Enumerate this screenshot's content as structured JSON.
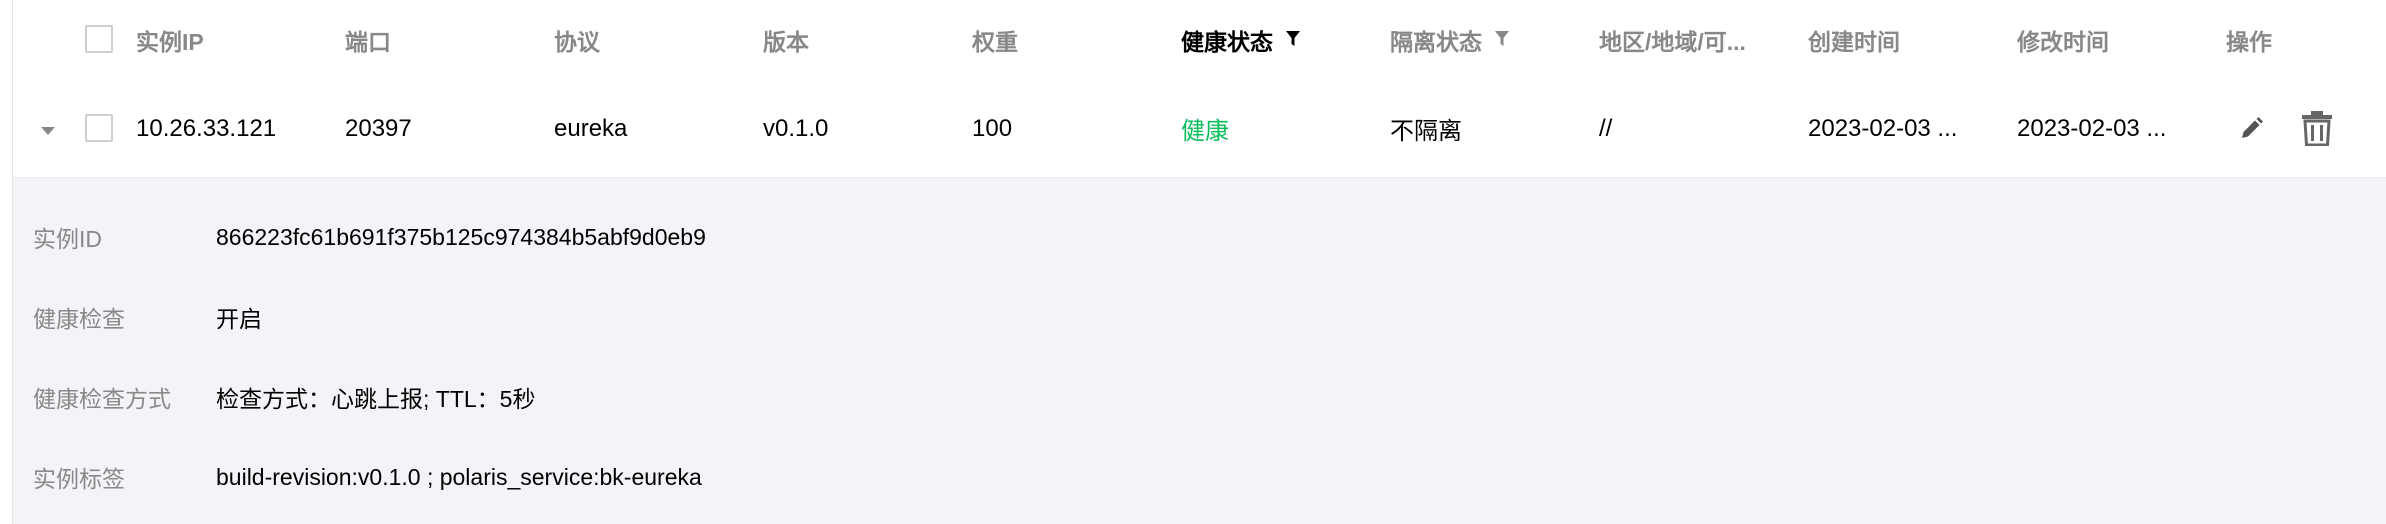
{
  "header": {
    "columns": [
      "实例IP",
      "端口",
      "协议",
      "版本",
      "权重",
      "健康状态",
      "隔离状态",
      "地区/地域/可...",
      "创建时间",
      "修改时间",
      "操作"
    ]
  },
  "row": {
    "ip": "10.26.33.121",
    "port": "20397",
    "protocol": "eureka",
    "version": "v0.1.0",
    "weight": "100",
    "health": "健康",
    "isolate": "不隔离",
    "location": "//",
    "created": "2023-02-03 ...",
    "modified": "2023-02-03 ..."
  },
  "detail": {
    "items": [
      {
        "label": "实例ID",
        "value": "866223fc61b691f375b125c974384b5abf9d0eb9"
      },
      {
        "label": "健康检查",
        "value": "开启"
      },
      {
        "label": "健康检查方式",
        "value": "检查方式：心跳上报; TTL：5秒"
      },
      {
        "label": "实例标签",
        "value": "build-revision:v0.1.0 ; polaris_service:bk-eureka"
      }
    ]
  },
  "colors": {
    "healthy": "#0abf5b",
    "header_text": "#888888",
    "detail_bg": "#f3f4f7"
  },
  "icons": [
    "filter-icon",
    "caret-down-icon",
    "edit-icon",
    "trash-icon"
  ]
}
